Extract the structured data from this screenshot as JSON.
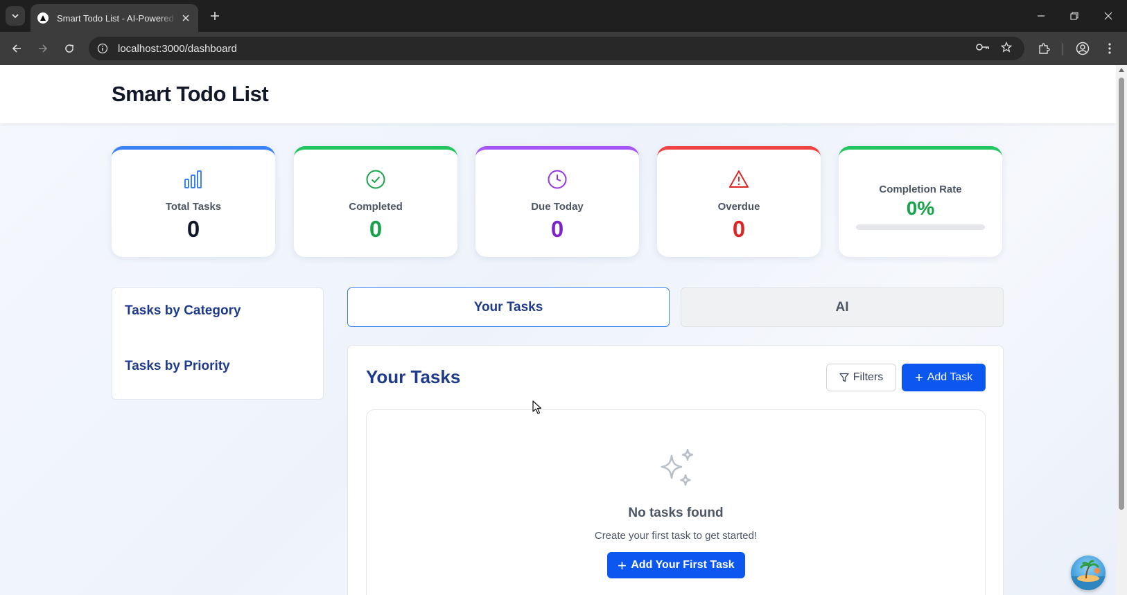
{
  "browser": {
    "tab_title": "Smart Todo List - AI-Powered Task",
    "url": "localhost:3000/dashboard"
  },
  "header": {
    "title": "Smart Todo List"
  },
  "stats": [
    {
      "label": "Total Tasks",
      "value": "0",
      "color": "#111827",
      "accent": "#3b82f6",
      "icon": "bar-chart-icon"
    },
    {
      "label": "Completed",
      "value": "0",
      "color": "#16a34a",
      "accent": "#22c55e",
      "icon": "check-circle-icon"
    },
    {
      "label": "Due Today",
      "value": "0",
      "color": "#7e22ce",
      "accent": "#a855f7",
      "icon": "clock-icon"
    },
    {
      "label": "Overdue",
      "value": "0",
      "color": "#dc2626",
      "accent": "#ef4444",
      "icon": "warning-icon"
    }
  ],
  "completion": {
    "label": "Completion Rate",
    "value": "0%",
    "progress": 0,
    "accent": "#22c55e"
  },
  "sidebar": {
    "category_title": "Tasks by Category",
    "priority_title": "Tasks by Priority"
  },
  "tabs": [
    {
      "label": "Your Tasks",
      "active": true
    },
    {
      "label": "AI",
      "active": false
    }
  ],
  "tasks": {
    "title": "Your Tasks",
    "filters_label": "Filters",
    "add_label": "Add Task",
    "empty_title": "No tasks found",
    "empty_subtitle": "Create your first task to get started!",
    "empty_button": "Add Your First Task"
  }
}
